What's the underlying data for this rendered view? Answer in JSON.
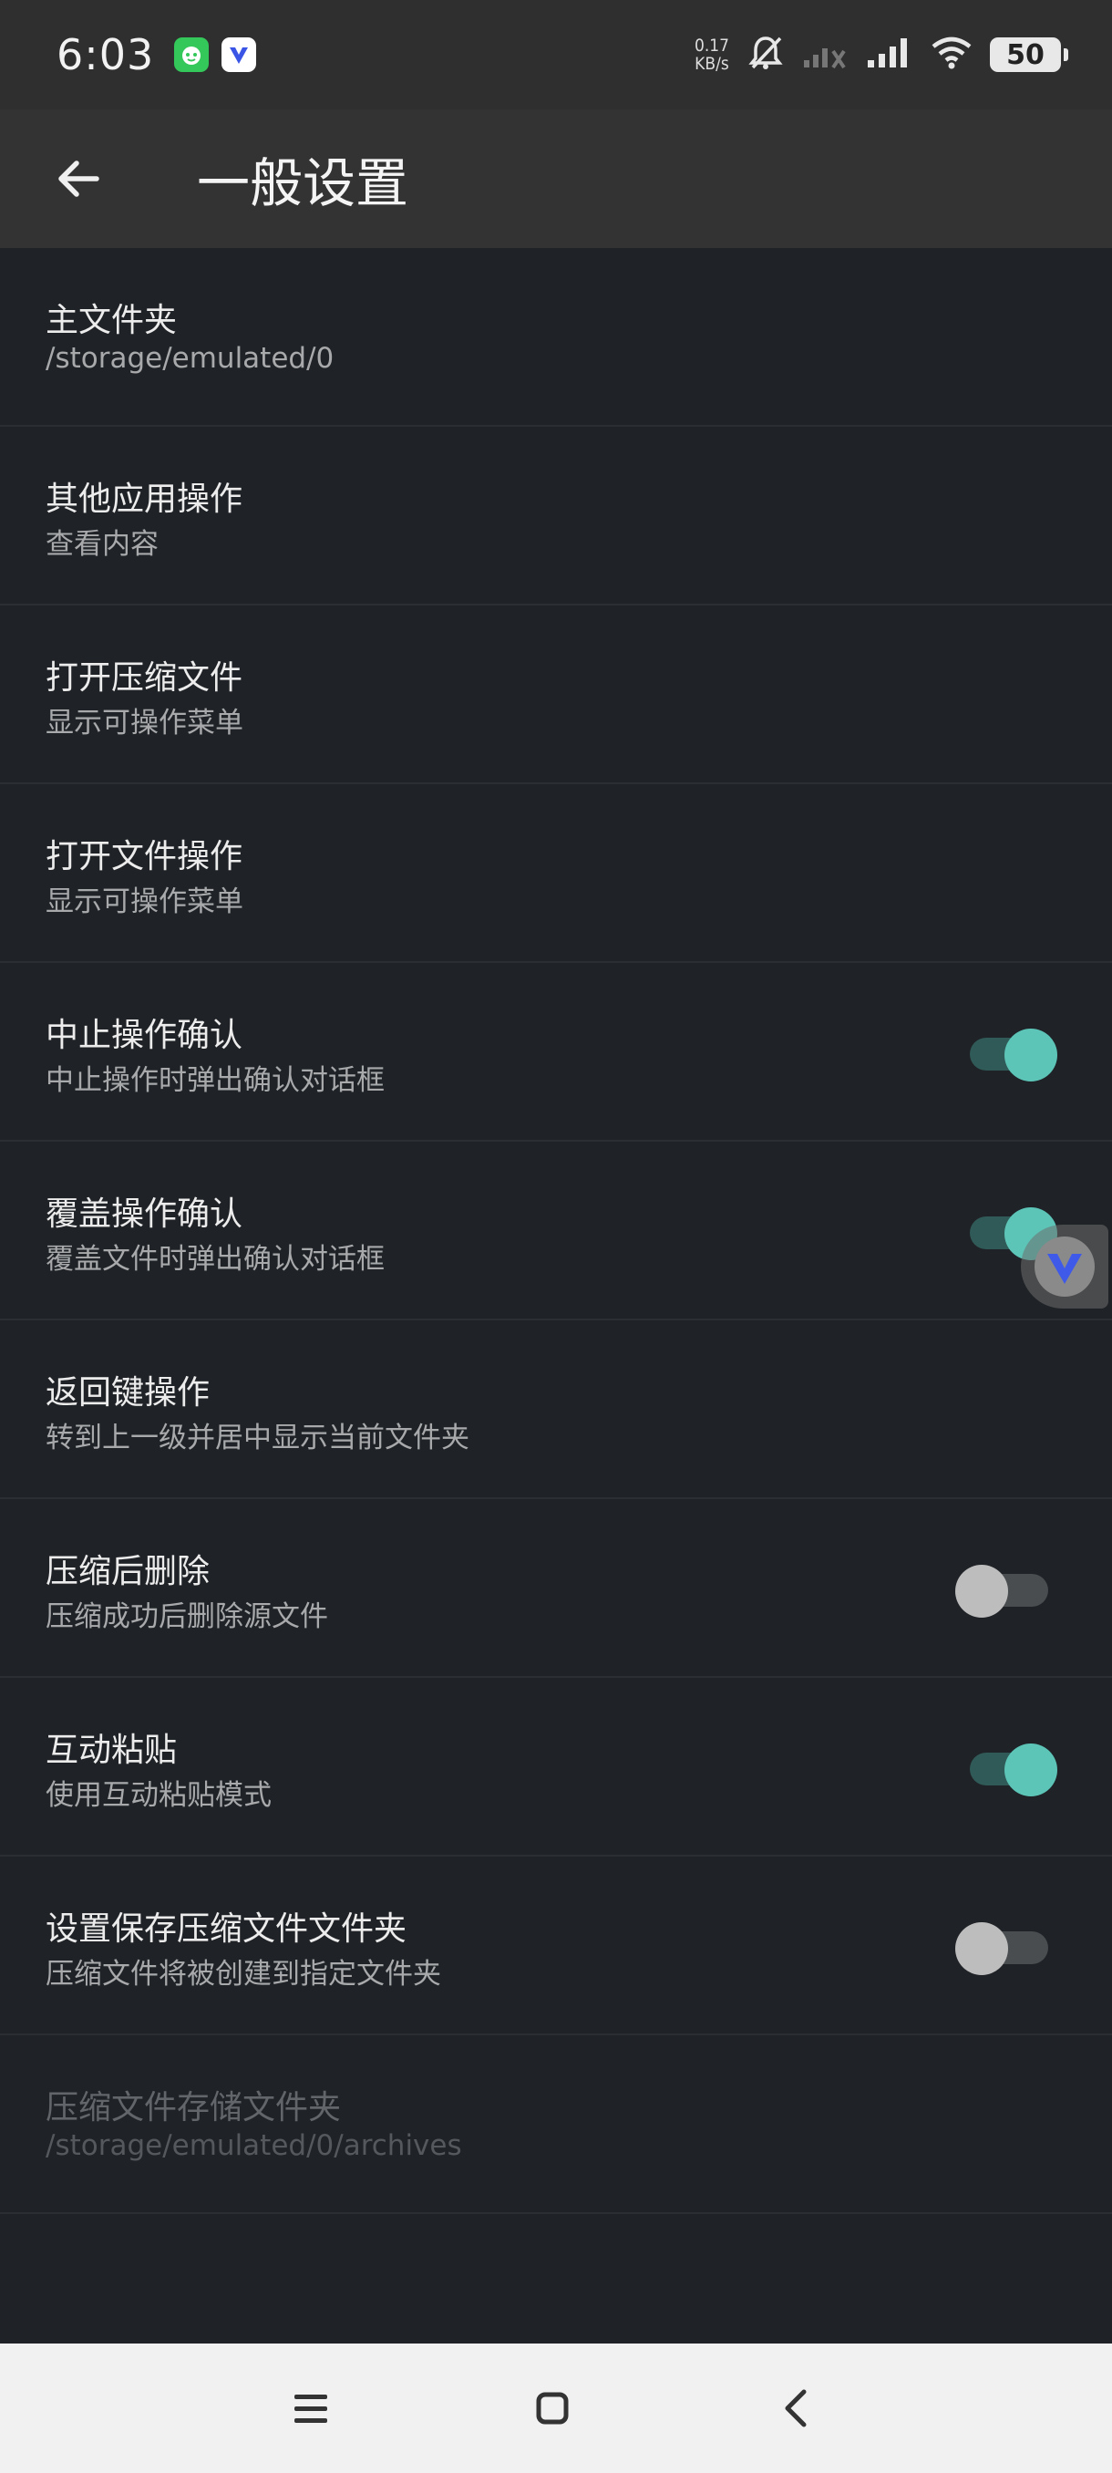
{
  "status_bar": {
    "time": "6:03",
    "net_speed_value": "0.17",
    "net_speed_unit": "KB/s",
    "battery": "50",
    "icons": [
      "app-icon-green",
      "app-icon-blue-v",
      "alarm-off-icon",
      "signal-weak-icon",
      "signal-icon",
      "wifi-icon",
      "battery-icon"
    ]
  },
  "app_bar": {
    "title": "一般设置",
    "back_icon": "arrow-left-icon"
  },
  "settings": [
    {
      "title": "主文件夹",
      "subtitle": "/storage/emulated/0",
      "toggle": null,
      "enabled": true
    },
    {
      "title": "其他应用操作",
      "subtitle": "查看内容",
      "toggle": null,
      "enabled": true
    },
    {
      "title": "打开压缩文件",
      "subtitle": "显示可操作菜单",
      "toggle": null,
      "enabled": true
    },
    {
      "title": "打开文件操作",
      "subtitle": "显示可操作菜单",
      "toggle": null,
      "enabled": true
    },
    {
      "title": "中止操作确认",
      "subtitle": "中止操作时弹出确认对话框",
      "toggle": true,
      "enabled": true
    },
    {
      "title": "覆盖操作确认",
      "subtitle": "覆盖文件时弹出确认对话框",
      "toggle": true,
      "enabled": true
    },
    {
      "title": "返回键操作",
      "subtitle": "转到上一级并居中显示当前文件夹",
      "toggle": null,
      "enabled": true
    },
    {
      "title": "压缩后删除",
      "subtitle": "压缩成功后删除源文件",
      "toggle": false,
      "enabled": true
    },
    {
      "title": "互动粘贴",
      "subtitle": "使用互动粘贴模式",
      "toggle": true,
      "enabled": true
    },
    {
      "title": "设置保存压缩文件文件夹",
      "subtitle": "压缩文件将被创建到指定文件夹",
      "toggle": false,
      "enabled": true
    },
    {
      "title": "压缩文件存储文件夹",
      "subtitle": "/storage/emulated/0/archives",
      "toggle": null,
      "enabled": false
    }
  ],
  "colors": {
    "background": "#1f2226",
    "app_bar": "#333333",
    "accent": "#5cc5b8",
    "toggle_off_thumb": "#bdbdbd",
    "nav_bar": "#f1f1f1"
  },
  "nav_bar": {
    "icons": [
      "menu-icon",
      "home-icon",
      "back-chevron-icon"
    ]
  }
}
